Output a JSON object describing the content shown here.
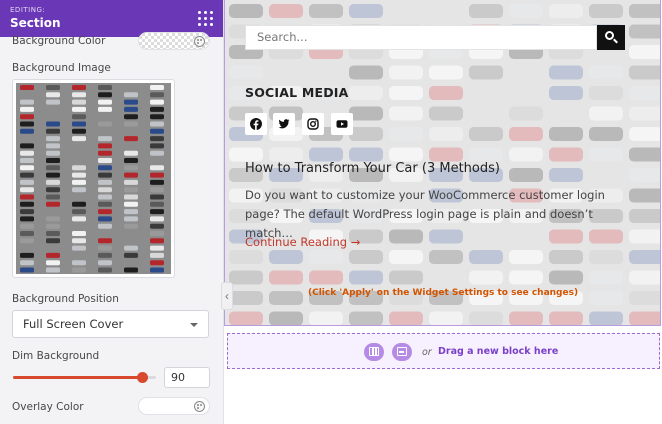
{
  "panel": {
    "editing_label": "EDITING:",
    "title": "Section",
    "background_color_label": "Background Color",
    "background_image_label": "Background Image",
    "background_position_label": "Background Position",
    "background_position_value": "Full Screen Cover",
    "dim_background_label": "Dim Background",
    "dim_background_value": "90",
    "dim_background_fraction": 0.9,
    "overlay_color_label": "Overlay Color"
  },
  "icons": {
    "grip": "drag-grip-icon",
    "palette": "palette-icon",
    "collapse": "chevron-left-icon",
    "search": "search-icon",
    "social": [
      "facebook-icon",
      "twitter-icon",
      "instagram-icon",
      "youtube-icon"
    ],
    "dropzone": [
      "columns-icon",
      "rows-icon"
    ]
  },
  "preview": {
    "search_placeholder": "Search...",
    "social_title": "SOCIAL MEDIA",
    "post_title": "How to Transform Your Car (3 Methods)",
    "post_excerpt": "Do you want to customize your WooCommerce customer login page? The default WordPress login page is plain and doesn’t match…",
    "read_more": "Continue Reading →",
    "apply_note": "(Click 'Apply' on the Widget Settings to see changes)"
  },
  "dropzone": {
    "or_text": "or",
    "drag_text": "Drag a new block here"
  },
  "colors": {
    "header": "#6a37b6",
    "accent": "#d9492e",
    "link": "#c0392b",
    "note": "#d35400",
    "dropzone_border": "#9b6bd8",
    "dropzone_text": "#7b3fc8"
  }
}
